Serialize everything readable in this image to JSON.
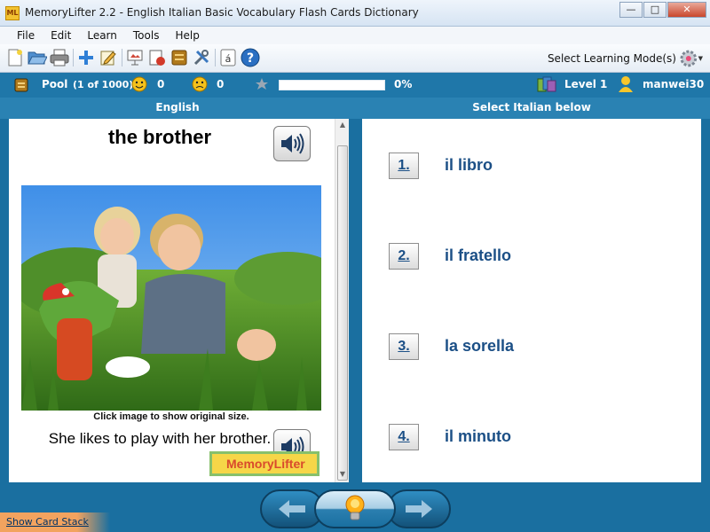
{
  "window": {
    "title": "MemoryLifter 2.2 - English Italian Basic Vocabulary Flash Cards Dictionary",
    "app_icon_text": "ML",
    "minimize": "—",
    "maximize": "□",
    "close": "✕"
  },
  "menu": [
    "File",
    "Edit",
    "Learn",
    "Tools",
    "Help"
  ],
  "toolbar": {
    "icons": [
      "new-icon",
      "open-icon",
      "print-icon",
      "add-card-icon",
      "edit-icon",
      "slideshow-icon",
      "statistics-icon",
      "drawer-icon",
      "settings-icon",
      "character-map-icon",
      "help-icon"
    ],
    "learning_mode_label": "Select Learning Mode(s)"
  },
  "status": {
    "pool_label": "Pool",
    "pool_count": "(1 of 1000)",
    "correct_count": "0",
    "wrong_count": "0",
    "progress_percent": "0%",
    "progress_value": 0,
    "level": "Level 1",
    "user": "manwei30"
  },
  "columns": {
    "question_language": "English",
    "answer_prompt": "Select Italian below"
  },
  "card": {
    "word": "the brother",
    "image_caption": "Click image to show original size.",
    "example_sentence": "She likes to play with her brother.",
    "logo_text": "MemoryLifter"
  },
  "answers": [
    {
      "number": "1.",
      "text": "il libro"
    },
    {
      "number": "2.",
      "text": "il fratello"
    },
    {
      "number": "3.",
      "text": "la sorella"
    },
    {
      "number": "4.",
      "text": "il minuto"
    }
  ],
  "footer": {
    "show_card_stack": "Show Card Stack"
  },
  "colors": {
    "frame": "#1a6fa0",
    "answer_text": "#1b4f86",
    "progress_fill": "#7bc24c"
  }
}
